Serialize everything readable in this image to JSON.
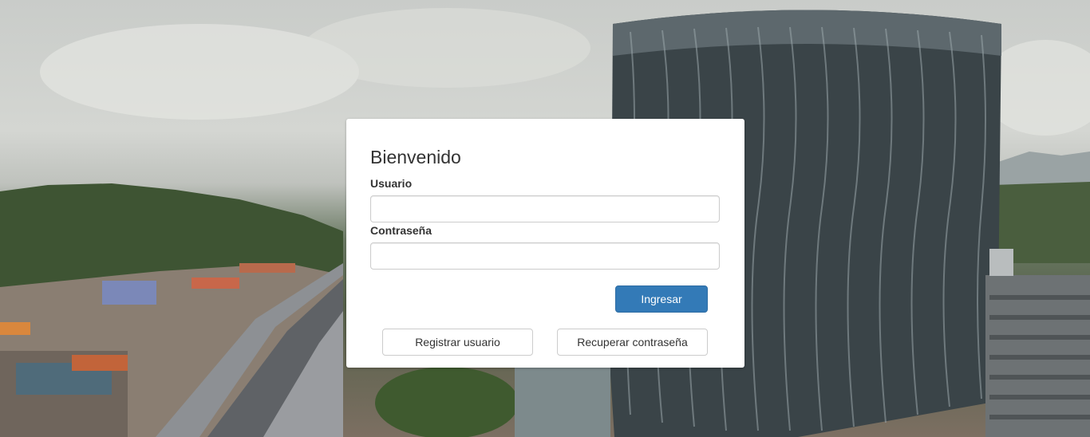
{
  "login": {
    "title": "Bienvenido",
    "username_label": "Usuario",
    "username_value": "",
    "password_label": "Contraseña",
    "password_value": "",
    "submit_label": "Ingresar",
    "register_label": "Registrar usuario",
    "recover_label": "Recuperar contraseña"
  },
  "colors": {
    "primary": "#337ab7",
    "card_background": "#ffffff"
  }
}
